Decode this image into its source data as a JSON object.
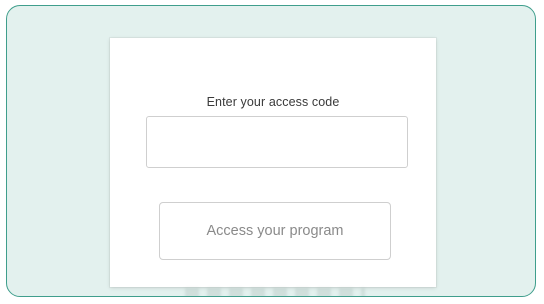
{
  "form": {
    "label": "Enter your access code",
    "input_value": "",
    "input_placeholder": "",
    "button_label": "Access your program"
  },
  "colors": {
    "frame_background": "#e3f1ee",
    "frame_border": "#3f9e8c",
    "card_background": "#ffffff",
    "button_text": "#8a8a8a"
  }
}
